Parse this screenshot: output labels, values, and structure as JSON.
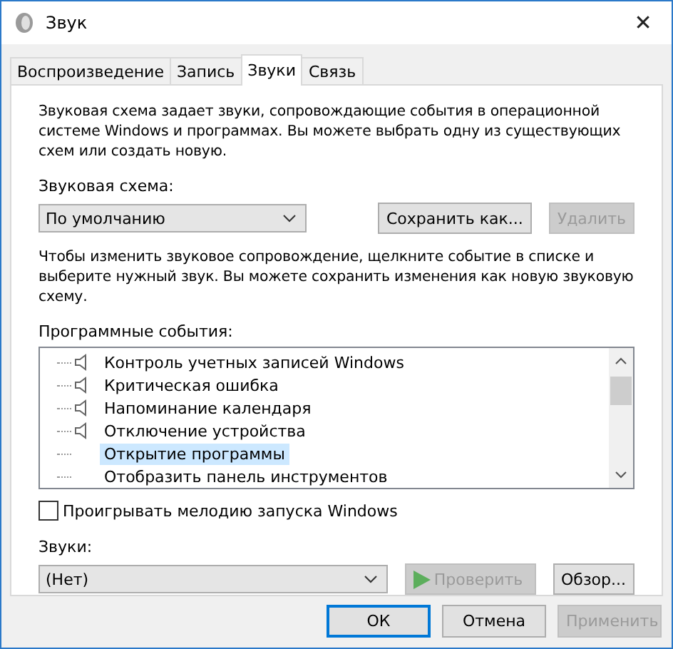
{
  "window": {
    "title": "Звук",
    "close": "✕"
  },
  "tabs": [
    {
      "label": "Воспроизведение",
      "selected": false
    },
    {
      "label": "Запись",
      "selected": false
    },
    {
      "label": "Звуки",
      "selected": true
    },
    {
      "label": "Связь",
      "selected": false
    }
  ],
  "intro": "Звуковая схема задает звуки, сопровождающие события в операционной системе Windows и программах. Вы можете выбрать одну из существующих схем или создать новую.",
  "scheme": {
    "label": "Звуковая схема:",
    "value": "По умолчанию",
    "save": {
      "label": "Сохранить как...",
      "disabled": false
    },
    "delete": {
      "label": "Удалить",
      "disabled": true
    }
  },
  "hint": "Чтобы изменить звуковое сопровождение, щелкните событие в списке и выберите нужный звук. Вы можете сохранить изменения как новую звуковую схему.",
  "events_label": "Программные события:",
  "events": [
    {
      "label": "Контроль учетных записей Windows",
      "has_sound": true,
      "selected": false
    },
    {
      "label": "Критическая ошибка",
      "has_sound": true,
      "selected": false
    },
    {
      "label": "Напоминание календаря",
      "has_sound": true,
      "selected": false
    },
    {
      "label": "Отключение устройства",
      "has_sound": true,
      "selected": false
    },
    {
      "label": "Открытие программы",
      "has_sound": false,
      "selected": true
    },
    {
      "label": "Отобразить панель инструментов",
      "has_sound": false,
      "selected": false
    }
  ],
  "startup": {
    "label": "Проигрывать мелодию запуска Windows",
    "checked": false
  },
  "sounds": {
    "label": "Звуки:",
    "value": "(Нет)",
    "test": {
      "label": "Проверить",
      "disabled": true
    },
    "browse": {
      "label": "Обзор...",
      "disabled": false
    }
  },
  "buttons": [
    {
      "label": "ОК",
      "disabled": false,
      "default": true
    },
    {
      "label": "Отмена",
      "disabled": false,
      "default": false
    },
    {
      "label": "Применить",
      "disabled": true,
      "default": false
    }
  ]
}
